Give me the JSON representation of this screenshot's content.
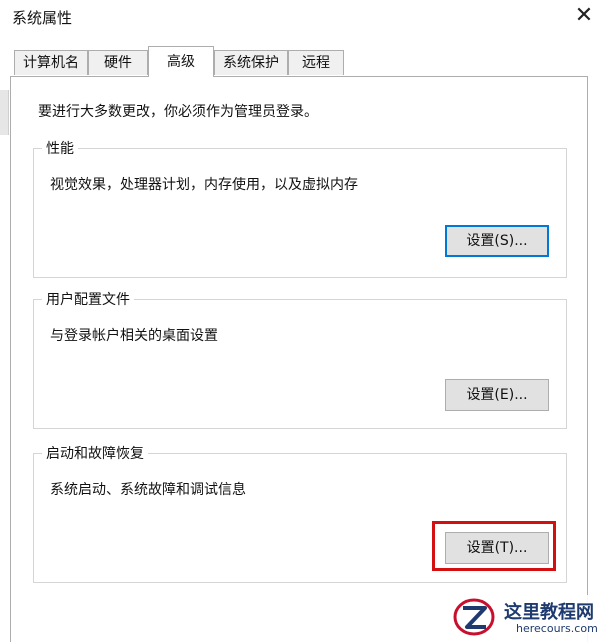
{
  "window": {
    "title": "系统属性",
    "close_glyph": "✕"
  },
  "tabs": [
    {
      "label": "计算机名"
    },
    {
      "label": "硬件"
    },
    {
      "label": "高级",
      "active": true
    },
    {
      "label": "系统保护"
    },
    {
      "label": "远程"
    }
  ],
  "notice": "要进行大多数更改，你必须作为管理员登录。",
  "groups": {
    "performance": {
      "title": "性能",
      "description": "视觉效果，处理器计划，内存使用，以及虚拟内存",
      "button": "设置(S)..."
    },
    "user_profiles": {
      "title": "用户配置文件",
      "description": "与登录帐户相关的桌面设置",
      "button": "设置(E)..."
    },
    "startup_recovery": {
      "title": "启动和故障恢复",
      "description": "系统启动、系统故障和调试信息",
      "button": "设置(T)..."
    }
  },
  "watermark": {
    "title": "这里教程网",
    "url": "herecours.com"
  },
  "colors": {
    "accent_focus": "#0078d7",
    "highlight_red": "#d30f0f"
  }
}
